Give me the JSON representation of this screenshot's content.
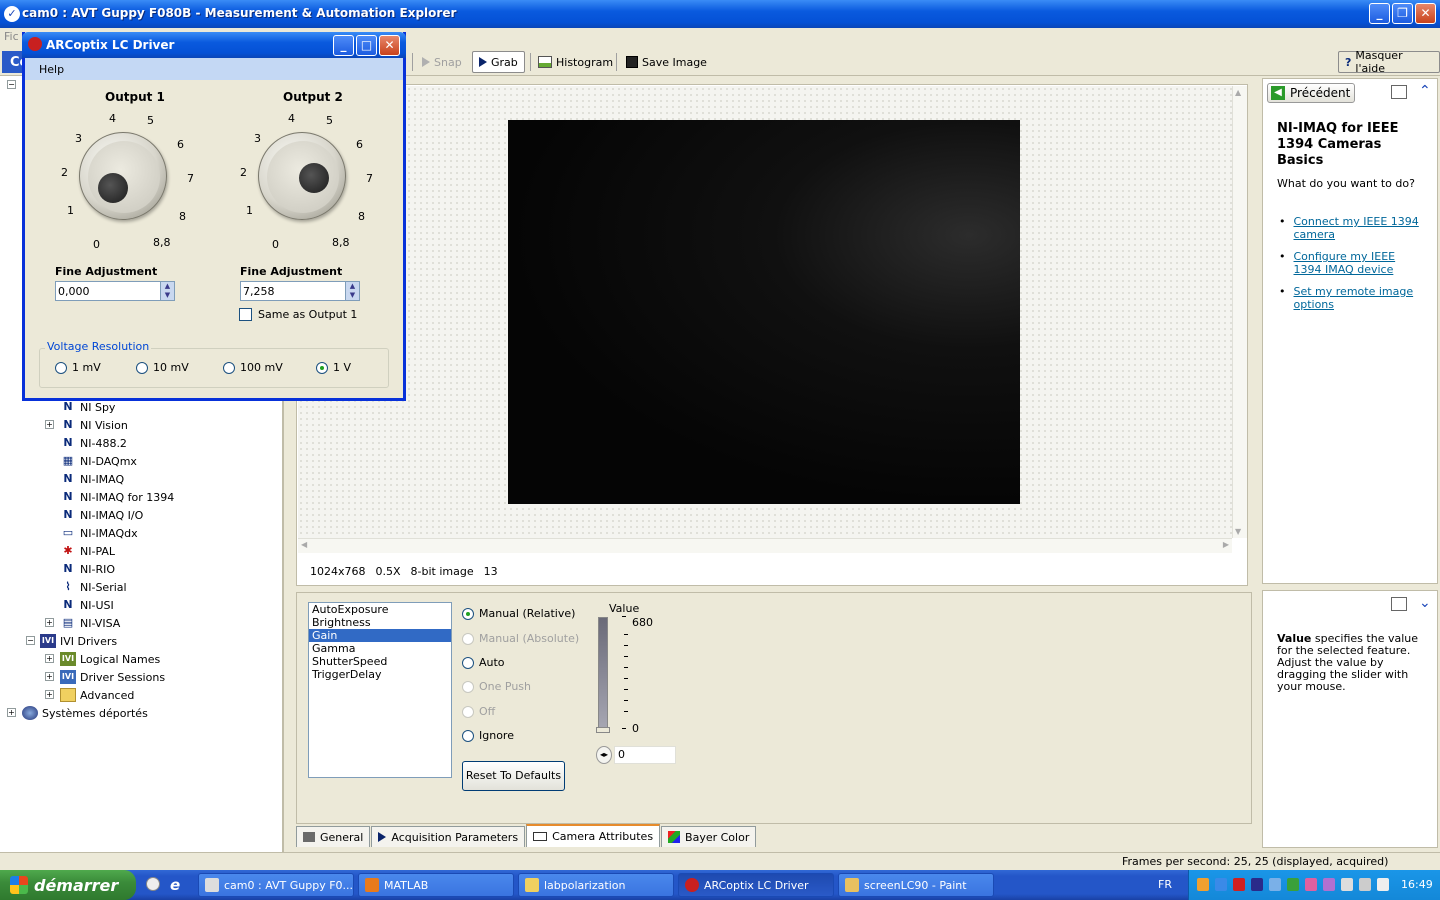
{
  "window": {
    "title": "cam0 : AVT Guppy F080B - Measurement & Automation Explorer"
  },
  "menubar": {
    "first": "Fic"
  },
  "toolbar": {
    "snap": "Snap",
    "grab": "Grab",
    "histogram": "Histogram",
    "save_image": "Save Image",
    "help_toggle": "Masquer l'aide",
    "config_prefix": "Co"
  },
  "tree": {
    "items": [
      {
        "label": "NI Spy"
      },
      {
        "label": "NI Vision"
      },
      {
        "label": "NI-488.2"
      },
      {
        "label": "NI-DAQmx"
      },
      {
        "label": "NI-IMAQ"
      },
      {
        "label": "NI-IMAQ for 1394"
      },
      {
        "label": "NI-IMAQ I/O"
      },
      {
        "label": "NI-IMAQdx"
      },
      {
        "label": "NI-PAL"
      },
      {
        "label": "NI-RIO"
      },
      {
        "label": "NI-Serial"
      },
      {
        "label": "NI-USI"
      },
      {
        "label": "NI-VISA"
      },
      {
        "label": "IVI Drivers"
      },
      {
        "label": "Logical Names"
      },
      {
        "label": "Driver Sessions"
      },
      {
        "label": "Advanced"
      },
      {
        "label": "Systèmes déportés"
      }
    ]
  },
  "viewer": {
    "resolution": "1024x768",
    "zoom": "0.5X",
    "depth": "8-bit image",
    "value": "13"
  },
  "attributes": {
    "list": [
      "AutoExposure",
      "Brightness",
      "Gain",
      "Gamma",
      "ShutterSpeed",
      "TriggerDelay"
    ],
    "selected": "Gain",
    "modes": {
      "manual_relative": "Manual (Relative)",
      "manual_absolute": "Manual (Absolute)",
      "auto": "Auto",
      "one_push": "One Push",
      "off": "Off",
      "ignore": "Ignore"
    },
    "reset": "Reset To Defaults",
    "value_label": "Value",
    "slider_max": "680",
    "slider_min": "0",
    "slider_level": 0.0,
    "value_input": "0"
  },
  "tabs": [
    "General",
    "Acquisition Parameters",
    "Camera Attributes",
    "Bayer Color"
  ],
  "help": {
    "back": "Précédent",
    "title": "NI-IMAQ for IEEE 1394 Cameras Basics",
    "question": "What do you want to do?",
    "links": [
      "Connect my IEEE 1394 camera",
      "Configure my IEEE 1394 IMAQ device",
      "Set my remote image options"
    ],
    "value_term": "Value",
    "value_desc": " specifies the value for the selected feature. Adjust the value by dragging the slider with your mouse."
  },
  "dialog": {
    "title": "ARCoptix LC Driver",
    "menu": "Help",
    "output1": {
      "label": "Output 1",
      "fine_label": "Fine Adjustment",
      "fine_value": "0,000"
    },
    "output2": {
      "label": "Output 2",
      "fine_label": "Fine Adjustment",
      "fine_value": "7,258",
      "same_as": "Same as Output 1"
    },
    "scale": [
      "0",
      "1",
      "2",
      "3",
      "4",
      "5",
      "6",
      "7",
      "8",
      "8,8"
    ],
    "voltage_title": "Voltage Resolution",
    "voltage_options": [
      "1 mV",
      "10 mV",
      "100 mV",
      "1 V"
    ],
    "voltage_selected": "1 V"
  },
  "statusbar": {
    "fps": "Frames per second: 25, 25 (displayed, acquired)"
  },
  "taskbar": {
    "start": "démarrer",
    "items": [
      "cam0 : AVT Guppy F0...",
      "MATLAB",
      "labpolarization",
      "ARCoptix LC Driver",
      "screenLC90 - Paint"
    ],
    "lang": "FR",
    "clock": "16:49"
  }
}
